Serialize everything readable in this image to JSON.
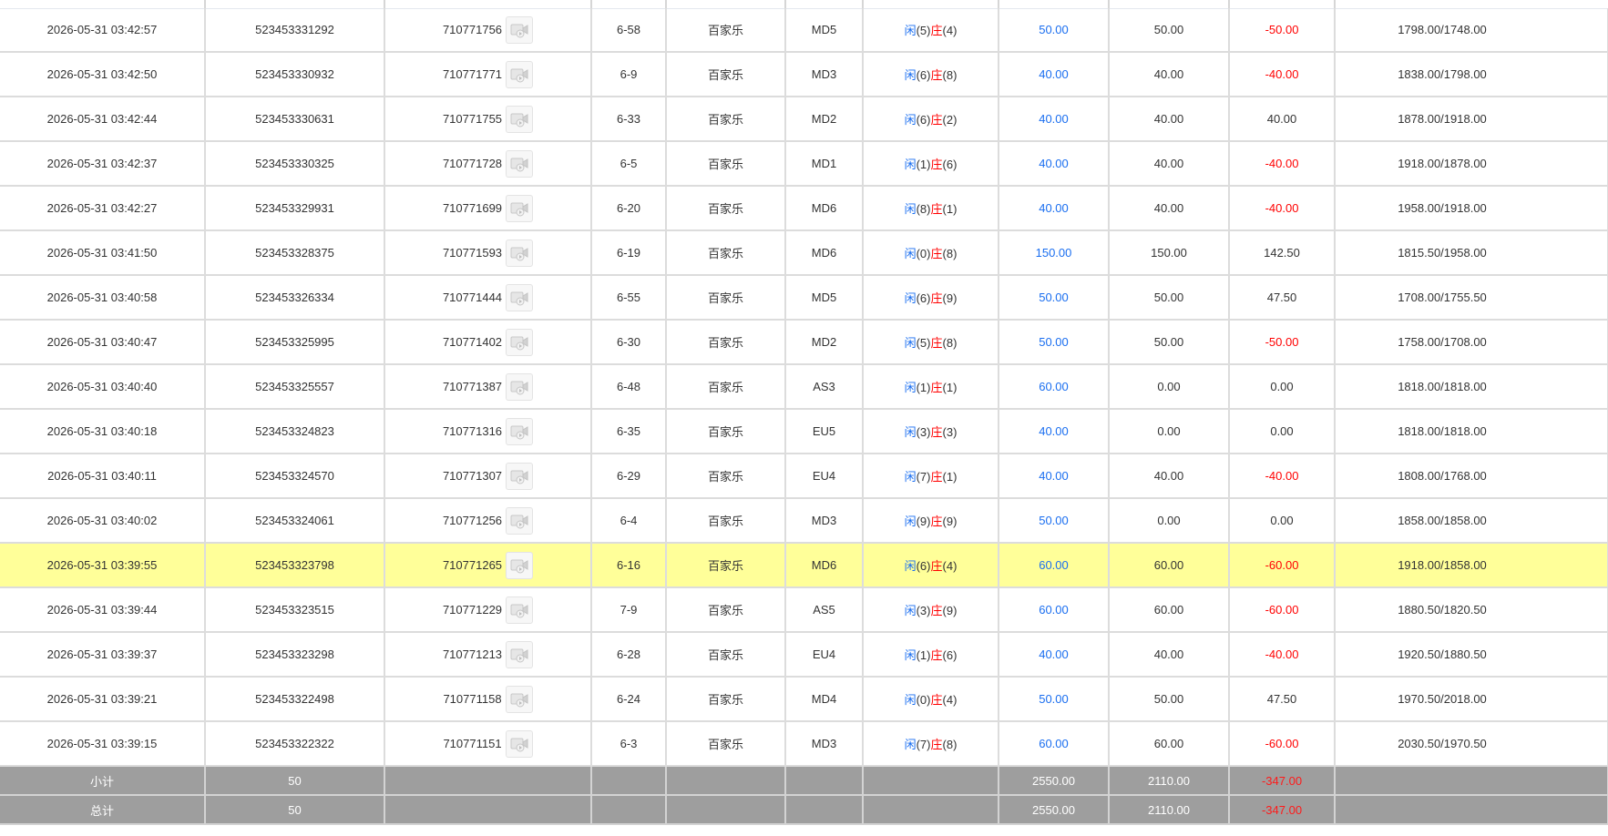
{
  "table": {
    "rows": [
      {
        "time": "2026-05-31 03:42:57",
        "bet_no": "523453331292",
        "round_no": "710771756",
        "shoe": "6-58",
        "game": "百家乐",
        "table_code": "MD5",
        "p": "5",
        "b": "4",
        "bet": "50.00",
        "valid": "50.00",
        "win": "-50.00",
        "win_neg": true,
        "balance": "1798.00/1748.00"
      },
      {
        "time": "2026-05-31 03:42:50",
        "bet_no": "523453330932",
        "round_no": "710771771",
        "shoe": "6-9",
        "game": "百家乐",
        "table_code": "MD3",
        "p": "6",
        "b": "8",
        "bet": "40.00",
        "valid": "40.00",
        "win": "-40.00",
        "win_neg": true,
        "balance": "1838.00/1798.00"
      },
      {
        "time": "2026-05-31 03:42:44",
        "bet_no": "523453330631",
        "round_no": "710771755",
        "shoe": "6-33",
        "game": "百家乐",
        "table_code": "MD2",
        "p": "6",
        "b": "2",
        "bet": "40.00",
        "valid": "40.00",
        "win": "40.00",
        "win_neg": false,
        "balance": "1878.00/1918.00"
      },
      {
        "time": "2026-05-31 03:42:37",
        "bet_no": "523453330325",
        "round_no": "710771728",
        "shoe": "6-5",
        "game": "百家乐",
        "table_code": "MD1",
        "p": "1",
        "b": "6",
        "bet": "40.00",
        "valid": "40.00",
        "win": "-40.00",
        "win_neg": true,
        "balance": "1918.00/1878.00"
      },
      {
        "time": "2026-05-31 03:42:27",
        "bet_no": "523453329931",
        "round_no": "710771699",
        "shoe": "6-20",
        "game": "百家乐",
        "table_code": "MD6",
        "p": "8",
        "b": "1",
        "bet": "40.00",
        "valid": "40.00",
        "win": "-40.00",
        "win_neg": true,
        "balance": "1958.00/1918.00"
      },
      {
        "time": "2026-05-31 03:41:50",
        "bet_no": "523453328375",
        "round_no": "710771593",
        "shoe": "6-19",
        "game": "百家乐",
        "table_code": "MD6",
        "p": "0",
        "b": "8",
        "bet": "150.00",
        "valid": "150.00",
        "win": "142.50",
        "win_neg": false,
        "balance": "1815.50/1958.00"
      },
      {
        "time": "2026-05-31 03:40:58",
        "bet_no": "523453326334",
        "round_no": "710771444",
        "shoe": "6-55",
        "game": "百家乐",
        "table_code": "MD5",
        "p": "6",
        "b": "9",
        "bet": "50.00",
        "valid": "50.00",
        "win": "47.50",
        "win_neg": false,
        "balance": "1708.00/1755.50"
      },
      {
        "time": "2026-05-31 03:40:47",
        "bet_no": "523453325995",
        "round_no": "710771402",
        "shoe": "6-30",
        "game": "百家乐",
        "table_code": "MD2",
        "p": "5",
        "b": "8",
        "bet": "50.00",
        "valid": "50.00",
        "win": "-50.00",
        "win_neg": true,
        "balance": "1758.00/1708.00"
      },
      {
        "time": "2026-05-31 03:40:40",
        "bet_no": "523453325557",
        "round_no": "710771387",
        "shoe": "6-48",
        "game": "百家乐",
        "table_code": "AS3",
        "p": "1",
        "b": "1",
        "bet": "60.00",
        "valid": "0.00",
        "win": "0.00",
        "win_neg": false,
        "balance": "1818.00/1818.00"
      },
      {
        "time": "2026-05-31 03:40:18",
        "bet_no": "523453324823",
        "round_no": "710771316",
        "shoe": "6-35",
        "game": "百家乐",
        "table_code": "EU5",
        "p": "3",
        "b": "3",
        "bet": "40.00",
        "valid": "0.00",
        "win": "0.00",
        "win_neg": false,
        "balance": "1818.00/1818.00"
      },
      {
        "time": "2026-05-31 03:40:11",
        "bet_no": "523453324570",
        "round_no": "710771307",
        "shoe": "6-29",
        "game": "百家乐",
        "table_code": "EU4",
        "p": "7",
        "b": "1",
        "bet": "40.00",
        "valid": "40.00",
        "win": "-40.00",
        "win_neg": true,
        "balance": "1808.00/1768.00"
      },
      {
        "time": "2026-05-31 03:40:02",
        "bet_no": "523453324061",
        "round_no": "710771256",
        "shoe": "6-4",
        "game": "百家乐",
        "table_code": "MD3",
        "p": "9",
        "b": "9",
        "bet": "50.00",
        "valid": "0.00",
        "win": "0.00",
        "win_neg": false,
        "balance": "1858.00/1858.00"
      },
      {
        "time": "2026-05-31 03:39:55",
        "bet_no": "523453323798",
        "round_no": "710771265",
        "shoe": "6-16",
        "game": "百家乐",
        "table_code": "MD6",
        "p": "6",
        "b": "4",
        "bet": "60.00",
        "valid": "60.00",
        "win": "-60.00",
        "win_neg": true,
        "balance": "1918.00/1858.00",
        "highlight": true
      },
      {
        "time": "2026-05-31 03:39:44",
        "bet_no": "523453323515",
        "round_no": "710771229",
        "shoe": "7-9",
        "game": "百家乐",
        "table_code": "AS5",
        "p": "3",
        "b": "9",
        "bet": "60.00",
        "valid": "60.00",
        "win": "-60.00",
        "win_neg": true,
        "balance": "1880.50/1820.50"
      },
      {
        "time": "2026-05-31 03:39:37",
        "bet_no": "523453323298",
        "round_no": "710771213",
        "shoe": "6-28",
        "game": "百家乐",
        "table_code": "EU4",
        "p": "1",
        "b": "6",
        "bet": "40.00",
        "valid": "40.00",
        "win": "-40.00",
        "win_neg": true,
        "balance": "1920.50/1880.50"
      },
      {
        "time": "2026-05-31 03:39:21",
        "bet_no": "523453322498",
        "round_no": "710771158",
        "shoe": "6-24",
        "game": "百家乐",
        "table_code": "MD4",
        "p": "0",
        "b": "4",
        "bet": "50.00",
        "valid": "50.00",
        "win": "47.50",
        "win_neg": false,
        "balance": "1970.50/2018.00"
      },
      {
        "time": "2026-05-31 03:39:15",
        "bet_no": "523453322322",
        "round_no": "710771151",
        "shoe": "6-3",
        "game": "百家乐",
        "table_code": "MD3",
        "p": "7",
        "b": "8",
        "bet": "60.00",
        "valid": "60.00",
        "win": "-60.00",
        "win_neg": true,
        "balance": "2030.50/1970.50"
      }
    ],
    "player_label": "闲",
    "banker_label": "庄",
    "subtotal": {
      "label": "小计",
      "count": "50",
      "bet": "2550.00",
      "valid": "2110.00",
      "win": "-347.00"
    },
    "total": {
      "label": "总计",
      "count": "50",
      "bet": "2550.00",
      "valid": "2110.00",
      "win": "-347.00"
    }
  },
  "colors": {
    "negative": "#ff0000",
    "bet_blue": "#1a6ef0",
    "highlight": "#ffff99",
    "summary_bg": "#9e9e9e"
  },
  "icons": {
    "replay": "replay-video-icon"
  }
}
